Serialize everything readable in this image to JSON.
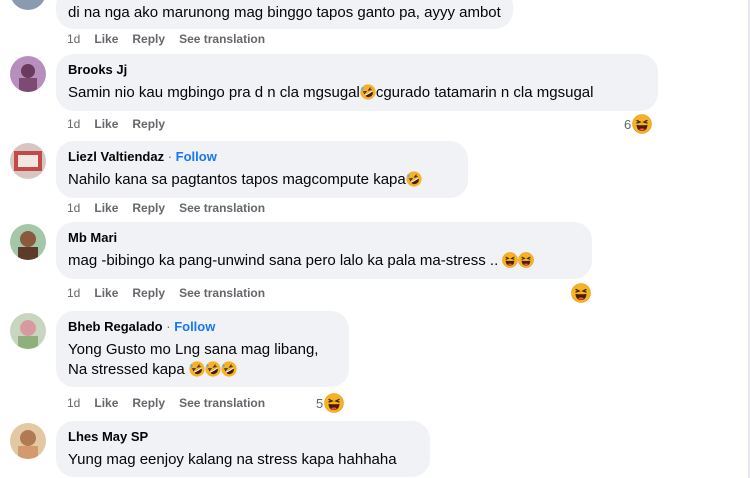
{
  "comments": [
    {
      "author": "",
      "text": "di na nga ako marunong mag binggo tapos ganto pa, ayyy ambot",
      "time": "1d",
      "like": "Like",
      "reply": "Reply",
      "translate": "See translation",
      "reactions": ""
    },
    {
      "author": "Brooks Jj",
      "text": "Samin nio kau mgbingo pra d n cla mgsugal",
      "text2": "cgurado tatamarin n cla mgsugal",
      "time": "1d",
      "like": "Like",
      "reply": "Reply",
      "reactions": "6"
    },
    {
      "author": "Liezl Valtiendaz",
      "follow": "Follow",
      "text": "Nahilo kana sa pagtantos tapos magcompute kapa",
      "time": "1d",
      "like": "Like",
      "reply": "Reply",
      "translate": "See translation"
    },
    {
      "author": "Mb Mari",
      "text": "mag -bibingo ka pang-unwind sana pero lalo ka pala ma-stress ..",
      "time": "1d",
      "like": "Like",
      "reply": "Reply",
      "translate": "See translation"
    },
    {
      "author": "Bheb Regalado",
      "follow": "Follow",
      "text": "Yong Gusto mo Lng sana mag libang,",
      "text2": "Na stressed kapa",
      "time": "1d",
      "like": "Like",
      "reply": "Reply",
      "translate": "See translation",
      "reactions": "5"
    },
    {
      "author": "Lhes May SP",
      "text": "Yung mag eenjoy kalang na stress kapa hahhaha"
    }
  ],
  "colors": {
    "bubble": "#f0f2f5",
    "follow": "#1877f2",
    "meta": "#65676b"
  },
  "icons": {
    "reaction": "laughing-emoji-icon"
  }
}
